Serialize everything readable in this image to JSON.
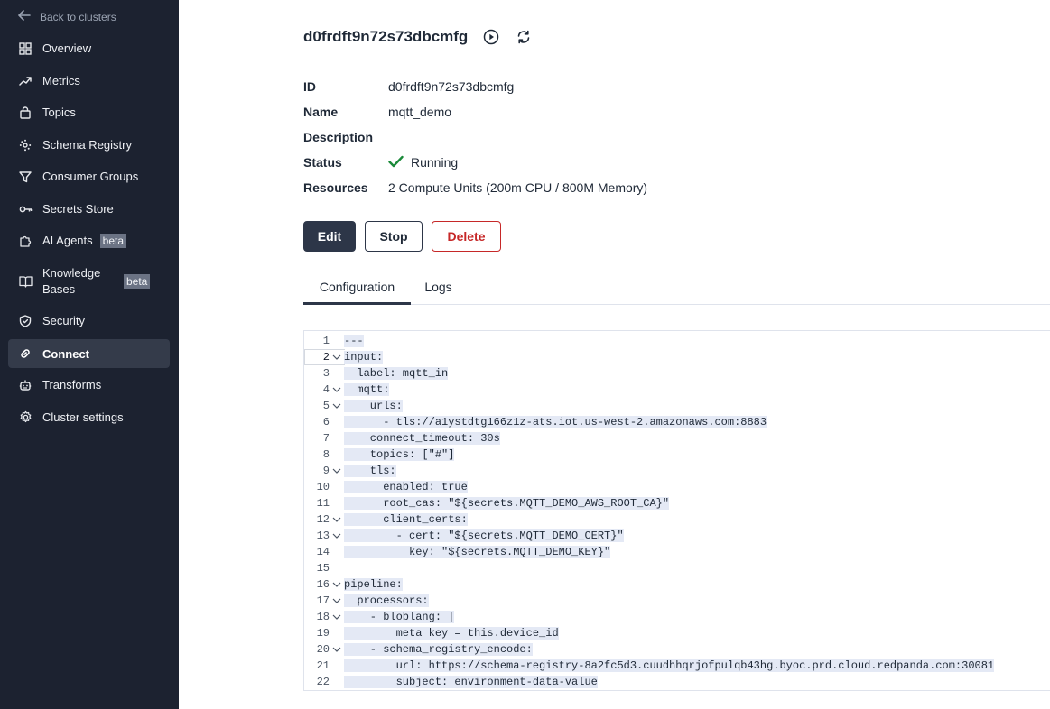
{
  "sidebar": {
    "back_label": "Back to clusters",
    "items": [
      {
        "label": "Overview",
        "icon": "grid-icon"
      },
      {
        "label": "Metrics",
        "icon": "trend-icon"
      },
      {
        "label": "Topics",
        "icon": "bag-icon"
      },
      {
        "label": "Schema Registry",
        "icon": "schema-icon"
      },
      {
        "label": "Consumer Groups",
        "icon": "funnel-icon"
      },
      {
        "label": "Secrets Store",
        "icon": "key-icon"
      },
      {
        "label": "AI Agents",
        "icon": "puzzle-icon",
        "badge": "beta"
      },
      {
        "label": "Knowledge Bases",
        "icon": "book-icon",
        "badge": "beta"
      },
      {
        "label": "Security",
        "icon": "shield-icon"
      },
      {
        "label": "Connect",
        "icon": "link-icon",
        "active": true
      },
      {
        "label": "Transforms",
        "icon": "robot-icon"
      },
      {
        "label": "Cluster settings",
        "icon": "gear-icon"
      }
    ]
  },
  "header": {
    "title": "d0frdft9n72s73dbcmfg"
  },
  "properties": {
    "id_label": "ID",
    "id_value": "d0frdft9n72s73dbcmfg",
    "name_label": "Name",
    "name_value": "mqtt_demo",
    "description_label": "Description",
    "description_value": "",
    "status_label": "Status",
    "status_value": "Running",
    "resources_label": "Resources",
    "resources_value": "2 Compute Units (200m CPU / 800M Memory)"
  },
  "actions": {
    "edit": "Edit",
    "stop": "Stop",
    "delete": "Delete"
  },
  "tabs": {
    "configuration": "Configuration",
    "logs": "Logs"
  },
  "colors": {
    "sidebar_bg": "#1c2230",
    "accent": "#2d3648",
    "danger": "#c62828",
    "success": "#1b8a3a"
  },
  "editor": {
    "current_line": 2,
    "lines": [
      {
        "n": "1",
        "fold": false,
        "text": "---"
      },
      {
        "n": "2",
        "fold": true,
        "text": "input:"
      },
      {
        "n": "3",
        "fold": false,
        "text": "  label: mqtt_in"
      },
      {
        "n": "4",
        "fold": true,
        "text": "  mqtt:"
      },
      {
        "n": "5",
        "fold": true,
        "text": "    urls:"
      },
      {
        "n": "6",
        "fold": false,
        "text": "      - tls://a1ystdtg166z1z-ats.iot.us-west-2.amazonaws.com:8883"
      },
      {
        "n": "7",
        "fold": false,
        "text": "    connect_timeout: 30s"
      },
      {
        "n": "8",
        "fold": false,
        "text": "    topics: [\"#\"]"
      },
      {
        "n": "9",
        "fold": true,
        "text": "    tls:"
      },
      {
        "n": "10",
        "fold": false,
        "text": "      enabled: true"
      },
      {
        "n": "11",
        "fold": false,
        "text": "      root_cas: \"${secrets.MQTT_DEMO_AWS_ROOT_CA}\""
      },
      {
        "n": "12",
        "fold": true,
        "text": "      client_certs:"
      },
      {
        "n": "13",
        "fold": true,
        "text": "        - cert: \"${secrets.MQTT_DEMO_CERT}\""
      },
      {
        "n": "14",
        "fold": false,
        "text": "          key: \"${secrets.MQTT_DEMO_KEY}\""
      },
      {
        "n": "15",
        "fold": false,
        "text": ""
      },
      {
        "n": "16",
        "fold": true,
        "text": "pipeline:"
      },
      {
        "n": "17",
        "fold": true,
        "text": "  processors:"
      },
      {
        "n": "18",
        "fold": true,
        "text": "    - bloblang: |"
      },
      {
        "n": "19",
        "fold": false,
        "text": "        meta key = this.device_id"
      },
      {
        "n": "20",
        "fold": true,
        "text": "    - schema_registry_encode:"
      },
      {
        "n": "21",
        "fold": false,
        "text": "        url: https://schema-registry-8a2fc5d3.cuudhhqrjofpulqb43hg.byoc.prd.cloud.redpanda.com:30081"
      },
      {
        "n": "22",
        "fold": false,
        "text": "        subject: environment-data-value"
      }
    ]
  }
}
